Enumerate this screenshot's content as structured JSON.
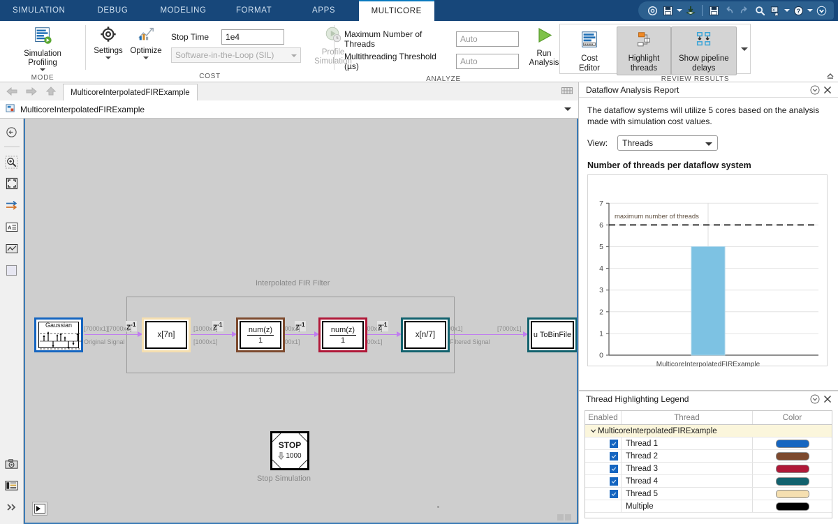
{
  "ribbon_tabs": [
    {
      "label": "SIMULATION",
      "active": false
    },
    {
      "label": "DEBUG",
      "active": false
    },
    {
      "label": "MODELING",
      "active": false
    },
    {
      "label": "FORMAT",
      "active": false
    },
    {
      "label": "APPS",
      "active": false
    },
    {
      "label": "MULTICORE",
      "active": true
    }
  ],
  "quick_access": [
    {
      "name": "preferences-gear-icon"
    },
    {
      "name": "save-icon"
    },
    {
      "name": "save-dropdown-caret-icon"
    },
    {
      "name": "open-download-icon"
    },
    {
      "name": "separator"
    },
    {
      "name": "save-model-icon"
    },
    {
      "name": "undo-icon"
    },
    {
      "name": "redo-icon"
    },
    {
      "name": "search-icon"
    },
    {
      "name": "find-favorites-icon"
    },
    {
      "name": "find-dropdown-caret-icon"
    },
    {
      "name": "help-icon"
    },
    {
      "name": "help-dropdown-caret-icon"
    },
    {
      "name": "collapse-toolbar-icon"
    }
  ],
  "ribbon": {
    "mode": {
      "group_label": "MODE",
      "simulation_profiling_label": "Simulation Profiling"
    },
    "cost": {
      "group_label": "COST",
      "settings_label": "Settings",
      "optimize_label": "Optimize",
      "stop_time_label": "Stop Time",
      "stop_time_value": "1e4",
      "sil_combo_value": "Software-in-the-Loop (SIL)",
      "profile_simulation_label": "Profile\nSimulation",
      "profile_simulation_line1": "Profile",
      "profile_simulation_line2": "Simulation"
    },
    "analyze": {
      "group_label": "ANALYZE",
      "max_threads_label": "Maximum Number of Threads",
      "max_threads_value": "Auto",
      "threshold_label": "Multithreading Threshold (µs)",
      "threshold_value": "Auto",
      "run_analysis_line1": "Run",
      "run_analysis_line2": "Analysis"
    },
    "review": {
      "group_label": "REVIEW RESULTS",
      "cost_editor_line1": "Cost",
      "cost_editor_line2": "Editor",
      "highlight_threads_line1": "Highlight",
      "highlight_threads_line2": "threads",
      "pipeline_delays_line1": "Show pipeline",
      "pipeline_delays_line2": "delays"
    }
  },
  "editor": {
    "model_tab_label": "MulticoreInterpolatedFIRExample",
    "breadcrumb_label": "MulticoreInterpolatedFIRExample",
    "left_tools": [
      {
        "name": "navigate-back-icon"
      },
      {
        "name": "zoom-in-icon"
      },
      {
        "name": "fit-to-view-icon"
      },
      {
        "name": "signal-routing-icon"
      },
      {
        "name": "annotation-icon"
      },
      {
        "name": "scope-icon"
      },
      {
        "name": "area-icon"
      },
      {
        "name": "camera-icon"
      },
      {
        "name": "legend-icon"
      },
      {
        "name": "more-tools-icon"
      }
    ]
  },
  "model": {
    "subsystem_caption": "Interpolated FIR Filter",
    "stop_caption": "Stop Simulation",
    "stop_label": "STOP",
    "stop_value": "1000",
    "blocks": [
      {
        "id": "gaussian",
        "label": "Gaussian",
        "border": "#1565C0",
        "kind": "source"
      },
      {
        "id": "upsample",
        "label": "x[7n]",
        "border": "#F5DFB0",
        "kind": "box"
      },
      {
        "id": "fir1",
        "label_num": "num(z)",
        "label_den": "1",
        "border": "#7D4A2E",
        "kind": "fraction"
      },
      {
        "id": "fir2",
        "label_num": "num(z)",
        "label_den": "1",
        "border": "#B01838",
        "kind": "fraction"
      },
      {
        "id": "downsample",
        "label": "x[n/7]",
        "border": "#12626E",
        "kind": "box"
      },
      {
        "id": "tobinfile",
        "label": "u  ToBinFile",
        "border": "#12626E",
        "kind": "box"
      }
    ],
    "signals": [
      {
        "text": "[7000x1]"
      },
      {
        "text": "[7000x1]"
      },
      {
        "text": "Original Signal"
      },
      {
        "text": "[1000x1]"
      },
      {
        "text": "[1000x1]"
      },
      {
        "text": "[1000x1]"
      },
      {
        "text": "[1000x1]"
      },
      {
        "text": "[1000x1]"
      },
      {
        "text": "[1000x1]"
      },
      {
        "text": "[7000x1]"
      },
      {
        "text": "[7000x1]"
      },
      {
        "text": "Filtered Signal"
      }
    ],
    "delay_label": "Z",
    "delay_exp": "-1"
  },
  "report_panel": {
    "title": "Dataflow Analysis Report",
    "description": "The dataflow systems will utilize 5 cores based on the analysis made with simulation cost values.",
    "view_label": "View:",
    "view_value": "Threads",
    "chart_title": "Number of threads per dataflow system"
  },
  "chart_data": {
    "type": "bar",
    "title": "Number of threads per dataflow system",
    "categories": [
      "MulticoreInterpolatedFIRExample"
    ],
    "values": [
      5
    ],
    "xlabel": "",
    "ylabel": "",
    "ylim": [
      0,
      7
    ],
    "yticks": [
      0,
      1,
      2,
      3,
      4,
      5,
      6,
      7
    ],
    "grid": true,
    "legend": "none",
    "bar_color": "#7DC2E3",
    "annotations": [
      {
        "type": "hline",
        "value": 6,
        "label": "maximum number of threads",
        "style": "dashed",
        "color": "#111111"
      }
    ]
  },
  "legend_panel": {
    "title": "Thread Highlighting Legend",
    "columns": [
      "Enabled",
      "Thread",
      "Color"
    ],
    "group_label": "MulticoreInterpolatedFIRExample",
    "rows": [
      {
        "label": "Thread 1",
        "enabled": true,
        "color": "#1565C0"
      },
      {
        "label": "Thread 2",
        "enabled": true,
        "color": "#7D4A2E"
      },
      {
        "label": "Thread 3",
        "enabled": true,
        "color": "#B01838"
      },
      {
        "label": "Thread 4",
        "enabled": true,
        "color": "#12626E"
      },
      {
        "label": "Thread 5",
        "enabled": true,
        "color": "#F5DFB0"
      },
      {
        "label": "Multiple",
        "enabled": false,
        "color": "#000000"
      }
    ]
  }
}
